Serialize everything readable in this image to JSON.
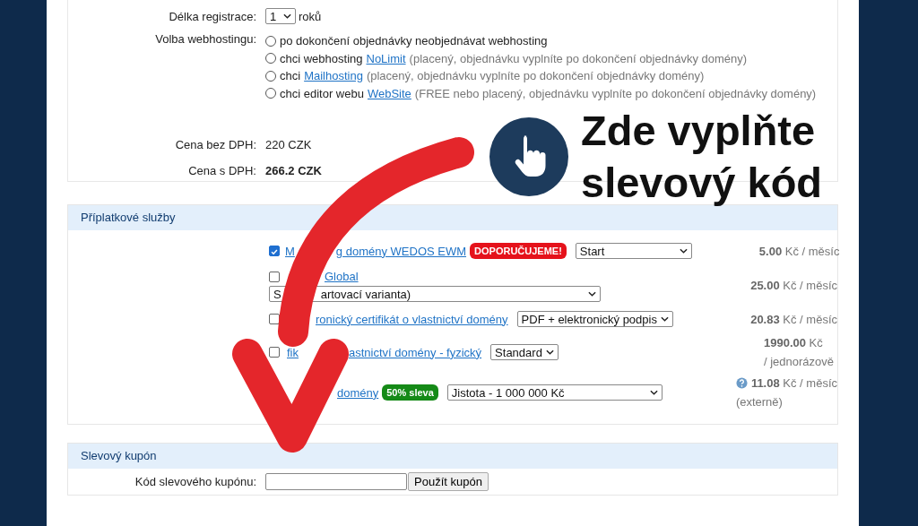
{
  "registration": {
    "label": "Délka registrace:",
    "select": "1",
    "unit": "roků"
  },
  "hosting": {
    "label": "Volba webhostingu:",
    "options": [
      {
        "selected": false,
        "parts": [
          {
            "kind": "plain",
            "text": "po dokončení objednávky neobjednávat webhosting"
          }
        ]
      },
      {
        "selected": false,
        "parts": [
          {
            "kind": "plain",
            "text": "chci webhosting"
          },
          {
            "kind": "link",
            "text": "NoLimit"
          },
          {
            "kind": "note",
            "text": "(placený, objednávku vyplníte po dokončení objednávky domény)"
          }
        ]
      },
      {
        "selected": false,
        "parts": [
          {
            "kind": "plain",
            "text": "chci"
          },
          {
            "kind": "link",
            "text": "Mailhosting"
          },
          {
            "kind": "note",
            "text": "(placený, objednávku vyplníte po dokončení objednávky domény)"
          }
        ]
      },
      {
        "selected": false,
        "parts": [
          {
            "kind": "plain",
            "text": "chci editor webu"
          },
          {
            "kind": "link",
            "text": "WebSite"
          },
          {
            "kind": "note",
            "text": "(FREE nebo placený, objednávku vyplníte po dokončení objednávky domény)"
          }
        ]
      }
    ]
  },
  "prices": [
    {
      "label": "Cena bez DPH:",
      "value": "220 CZK",
      "bold": false
    },
    {
      "label": "Cena s DPH:",
      "value": "266.2 CZK",
      "bold": true
    }
  ],
  "services": {
    "title": "Příplatkové služby",
    "items": [
      {
        "checked": true,
        "name": [
          "M",
          "g domény WEDOS EWM"
        ],
        "badge": {
          "text": "DOPORUČUJEME!",
          "color": "#e5121b"
        },
        "select": [
          "Start"
        ],
        "kind": "inline",
        "price": {
          "amount": "5.00",
          "unit": "Kč / měsíc"
        }
      },
      {
        "checked": false,
        "name": [
          "Global"
        ],
        "select": [
          "S",
          "artovací varianta)"
        ],
        "kind": "stacked",
        "price": {
          "amount": "25.00",
          "unit": "Kč / měsíc"
        }
      },
      {
        "checked": false,
        "name": [
          "ronický certifikát o vlastnictví domény"
        ],
        "select": [
          "PDF + elektronický podpis"
        ],
        "kind": "inline",
        "price": {
          "amount": "20.83",
          "unit": "Kč / měsíc"
        }
      },
      {
        "checked": false,
        "name": [
          "fik",
          "astnictví domény - fyzický"
        ],
        "select": [
          "Standard"
        ],
        "kind": "inline",
        "price": {
          "amount": "1990.00",
          "unit": "Kč",
          "note": "/ jednorázově"
        }
      },
      {
        "name": [
          "domény"
        ],
        "badge": {
          "text": "50% sleva",
          "color": "#158a17"
        },
        "select": [
          "Jistota - 1 000 000 Kč"
        ],
        "kind": "inline",
        "price": {
          "info": true,
          "amount": "11.08",
          "unit": "Kč / měsíc",
          "note": "(externě)"
        }
      }
    ]
  },
  "coupon": {
    "title": "Slevový kupón",
    "label": "Kód slevového kupónu:",
    "button": "Použít kupón"
  },
  "callout": {
    "lines": [
      "Zde vyplňte",
      "slevový kód"
    ]
  }
}
